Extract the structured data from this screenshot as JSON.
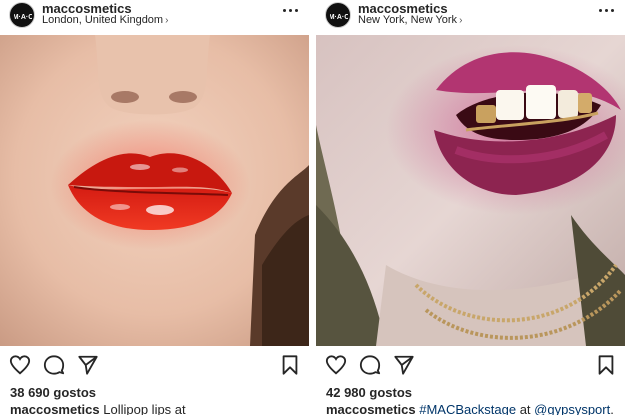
{
  "posts": [
    {
      "username": "maccosmetics",
      "location": "London, United Kingdom",
      "likes": "38 690 gostos",
      "caption": {
        "user": "maccosmetics",
        "text": "Lollipop lips at"
      },
      "photo_icon": "red-glossy-lips-photo"
    },
    {
      "username": "maccosmetics",
      "location": "New York, New York",
      "likes": "42 980 gostos",
      "caption": {
        "user": "maccosmetics",
        "tag1": "#MACBackstage",
        "mid": " at ",
        "tag2": "@gypsysport",
        "end": "."
      },
      "photo_icon": "pink-lips-grill-photo"
    }
  ],
  "icons": {
    "avatar": "mac-logo-icon",
    "more": "more-options-icon",
    "like": "heart-icon",
    "comment": "comment-icon",
    "share": "share-icon",
    "save": "bookmark-icon",
    "location_chevron": "chevron-right-icon"
  },
  "colors": {
    "text": "#262626",
    "hashtag": "#003569",
    "lipstick_red": "#e3261f",
    "lipstick_pink": "#b23571"
  }
}
